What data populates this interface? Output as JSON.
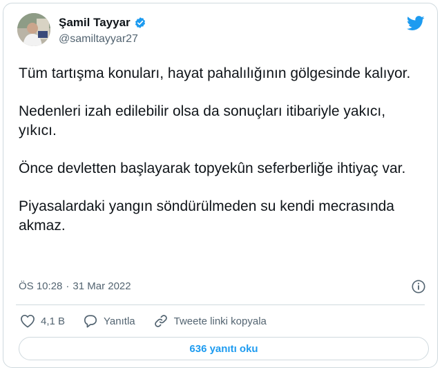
{
  "author": {
    "name": "Şamil Tayyar",
    "handle": "@samiltayyar27",
    "verified": true
  },
  "tweet": {
    "paragraphs": [
      "Tüm tartışma konuları, hayat pahalılığının gölgesinde kalıyor.",
      "Nedenleri izah edilebilir olsa da sonuçları itibariyle yakıcı, yıkıcı.",
      "Önce devletten başlayarak topyekûn seferberliğe ihtiyaç var.",
      "Piyasalardaki yangın söndürülmeden su kendi mecrasında akmaz."
    ],
    "time": "ÖS 10:28",
    "separator": "·",
    "date": "31 Mar 2022"
  },
  "actions": {
    "like_count": "4,1 B",
    "reply_label": "Yanıtla",
    "copy_link_label": "Tweete linki kopyala"
  },
  "replies_button_label": "636 yanıtı oku",
  "icons": {
    "brand": "twitter-bird-icon",
    "verified": "verified-badge-icon",
    "info": "info-icon",
    "like": "heart-icon",
    "reply": "speech-bubble-icon",
    "link": "link-icon"
  },
  "colors": {
    "accent": "#1d9bf0",
    "text": "#0f1419",
    "muted": "#536471",
    "border": "#cfd9de"
  }
}
